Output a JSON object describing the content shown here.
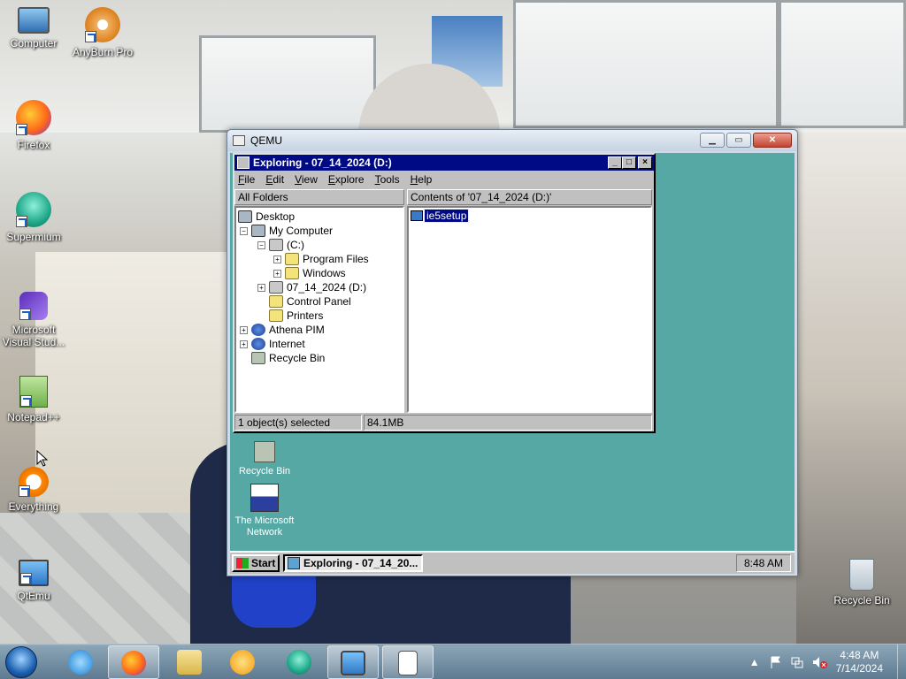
{
  "desktop_icons": [
    {
      "label": "Computer"
    },
    {
      "label": "AnyBurn Pro"
    },
    {
      "label": "Firefox"
    },
    {
      "label": "Supermium"
    },
    {
      "label": "Microsoft Visual Stud..."
    },
    {
      "label": "Notepad++"
    },
    {
      "label": "Everything"
    },
    {
      "label": "QtEmu"
    },
    {
      "label": "Recycle Bin"
    }
  ],
  "qemu": {
    "title": "QEMU",
    "min_glyph": "▁",
    "max_glyph": "▭",
    "close_glyph": "✕"
  },
  "explorer": {
    "title": "Exploring - 07_14_2024 (D:)",
    "menu": [
      "File",
      "Edit",
      "View",
      "Explore",
      "Tools",
      "Help"
    ],
    "all_folders_label": "All Folders",
    "contents_label": "Contents of '07_14_2024 (D:)'",
    "tree": [
      {
        "label": "Desktop"
      },
      {
        "label": "My Computer"
      },
      {
        "label": "(C:)"
      },
      {
        "label": "Program Files"
      },
      {
        "label": "Windows"
      },
      {
        "label": "07_14_2024 (D:)"
      },
      {
        "label": "Control Panel"
      },
      {
        "label": "Printers"
      },
      {
        "label": "Athena PIM"
      },
      {
        "label": "Internet"
      },
      {
        "label": "Recycle Bin"
      }
    ],
    "selected_file": "ie5setup",
    "status_left": "1 object(s) selected",
    "status_right": "84.1MB"
  },
  "guest_desktop": {
    "icons": [
      {
        "label": "Recycle Bin"
      },
      {
        "label": "The Microsoft Network"
      }
    ],
    "taskbar": {
      "start_label": "Start",
      "task_label": "Exploring - 07_14_20...",
      "clock": "8:48 AM"
    }
  },
  "host_taskbar": {
    "time": "4:48 AM",
    "date": "7/14/2024",
    "tray_arrow": "▲"
  },
  "colors": {
    "guest_desktop": "#56a8a4",
    "win95_titlebar": "#000a84"
  }
}
